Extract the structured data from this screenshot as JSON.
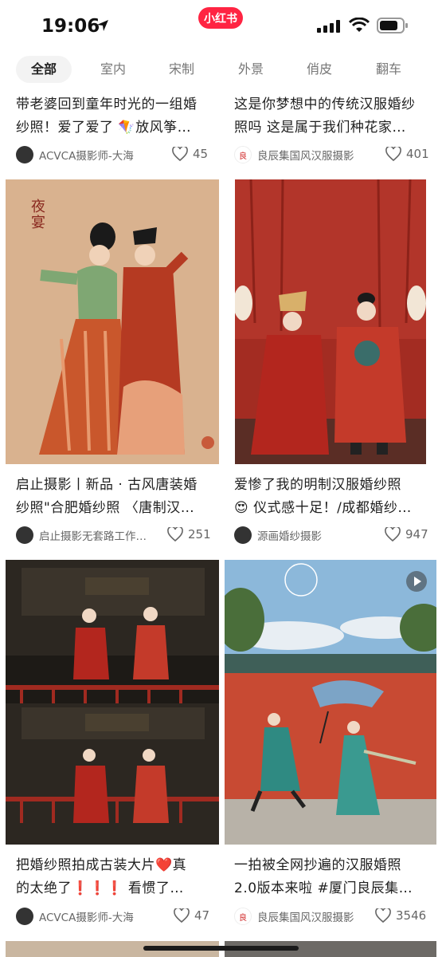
{
  "status": {
    "time": "19:06"
  },
  "app": {
    "badge": "小红书"
  },
  "tabs": [
    "全部",
    "室内",
    "宋制",
    "外景",
    "俏皮",
    "翻车"
  ],
  "cards": [
    {
      "title1": "带老婆回到童年时光的一组婚",
      "title2": "纱照！爱了爱了 🪁放风筝…",
      "author": "ACVCA摄影师-大海",
      "likes": "45"
    },
    {
      "title1": "这是你梦想中的传统汉服婚纱",
      "title2": "照吗 这是属于我们种花家…",
      "author": "良辰集国风汉服摄影",
      "likes": "401"
    },
    {
      "title1": "启止摄影丨新品 · 古风唐装婚",
      "title2": "纱照\"合肥婚纱照 〈唐制汉…",
      "author": "启止摄影无套路工作…",
      "likes": "251"
    },
    {
      "title1": "爱惨了我的明制汉服婚纱照",
      "title2": "😍 仪式感十足！/成都婚纱…",
      "author": "源画婚纱摄影",
      "likes": "947"
    },
    {
      "title1": "把婚纱照拍成古装大片❤️真",
      "title2": "的太绝了❗❗❗ 看惯了…",
      "author": "ACVCA摄影师-大海",
      "likes": "47"
    },
    {
      "title1": "一拍被全网抄遍的汉服婚照",
      "title2": "2.0版本来啦 #厦门良辰集…",
      "author": "良辰集国风汉服摄影",
      "likes": "3546"
    }
  ],
  "colors": {
    "accent": "#ff2442",
    "red_wall": "#b8452f",
    "sky": "#8fb9d8",
    "beige": "#d9b48f"
  }
}
